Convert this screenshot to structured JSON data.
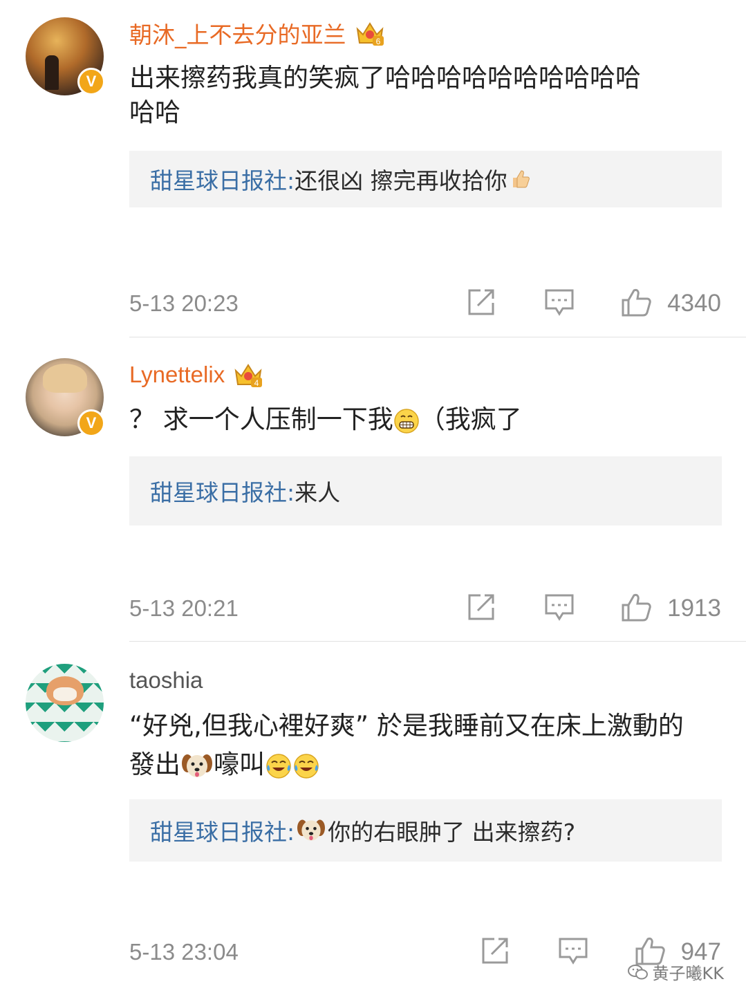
{
  "comments": [
    {
      "username": "朝沐_上不去分的亚兰",
      "level": "6",
      "verified": "V",
      "text_line1": "出来擦药我真的笑疯了哈哈哈哈哈哈哈哈哈哈",
      "text_line2": "哈哈",
      "reply_author": "甜星球日报社:",
      "reply_text": " 还很凶 擦完再收拾你",
      "time": "5-13 20:23",
      "likes": "4340"
    },
    {
      "username": "Lynettelix",
      "level": "4",
      "verified": "V",
      "text_pre": "？ 求一个人压制一下我",
      "text_post": "（我疯了",
      "reply_author": "甜星球日报社:",
      "reply_text": " 来人",
      "time": "5-13 20:21",
      "likes": "1913"
    },
    {
      "username": "taoshia",
      "text_line1": "“好兇,但我心裡好爽” 於是我睡前又在床上激動的",
      "text_line2_pre": "發出",
      "text_line2_post": "嚎叫",
      "reply_author": "甜星球日报社:",
      "reply_text": "你的右眼肿了 出来擦药?",
      "time": "5-13 23:04",
      "likes": "947"
    }
  ],
  "watermark": "黄子曦KK",
  "colors": {
    "vip_name": "#e86a25",
    "reply_author": "#3a6ea5",
    "meta_gray": "#8b8b8b",
    "reply_bg": "#f3f3f3",
    "badge": "#f2a618"
  },
  "icons": [
    "crown-icon",
    "verified-badge-icon",
    "share-icon",
    "comment-icon",
    "like-icon",
    "thumbs-up-emoji",
    "grin-emoji",
    "dog-emoji",
    "crying-laugh-emoji",
    "wechat-icon"
  ]
}
